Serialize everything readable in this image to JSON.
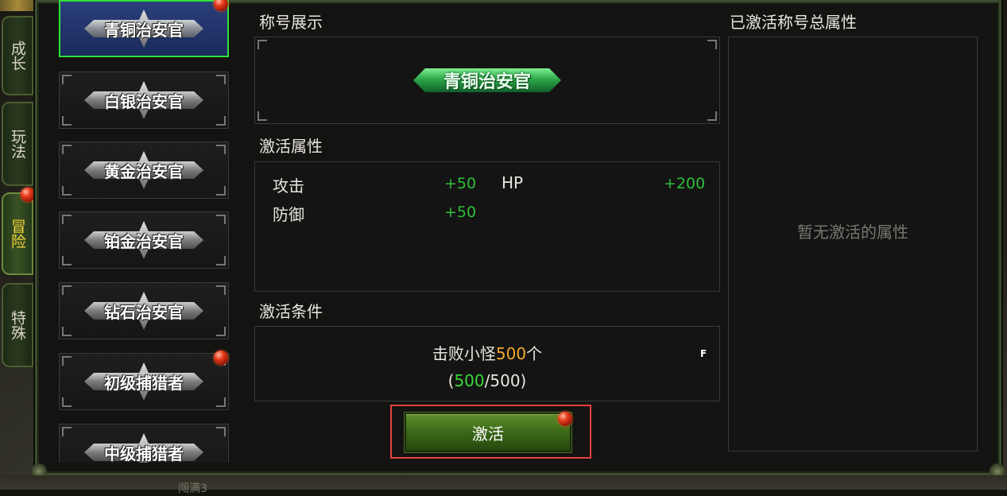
{
  "side_tabs": [
    {
      "label": "成长",
      "active": false
    },
    {
      "label": "玩法",
      "active": false
    },
    {
      "label": "冒险",
      "active": true,
      "notification": true
    },
    {
      "label": "特殊",
      "active": false
    }
  ],
  "titles": [
    {
      "label": "青铜治安官",
      "selected": true,
      "notification": true
    },
    {
      "label": "白银治安官",
      "selected": false
    },
    {
      "label": "黄金治安官",
      "selected": false
    },
    {
      "label": "铂金治安官",
      "selected": false
    },
    {
      "label": "钻石治安官",
      "selected": false
    },
    {
      "label": "初级捕猎者",
      "selected": false,
      "notification": true
    },
    {
      "label": "中级捕猎者",
      "selected": false
    }
  ],
  "display": {
    "section_label": "称号展示",
    "badge_label": "青铜治安官"
  },
  "attributes": {
    "section_label": "激活属性",
    "items": [
      {
        "name": "攻击",
        "value": "+50"
      },
      {
        "name": "HP",
        "value": "+200"
      },
      {
        "name": "防御",
        "value": "+50"
      }
    ]
  },
  "conditions": {
    "section_label": "激活条件",
    "text_prefix": "击败小怪",
    "count": "500",
    "text_suffix": "个",
    "progress_open": "(",
    "progress_current": "500",
    "progress_total": "/500)",
    "hotkey": "F"
  },
  "activate_button": {
    "label": "激活",
    "notification": true
  },
  "summary": {
    "section_label": "已激活称号总属性",
    "empty_text": "暂无激活的属性"
  },
  "bottom": {
    "text": "闯满3"
  },
  "colors": {
    "accent_green": "#2fe23a",
    "gold": "#f2a82a",
    "value_green": "#2fbf3a",
    "highlight_red": "#e8403a"
  }
}
